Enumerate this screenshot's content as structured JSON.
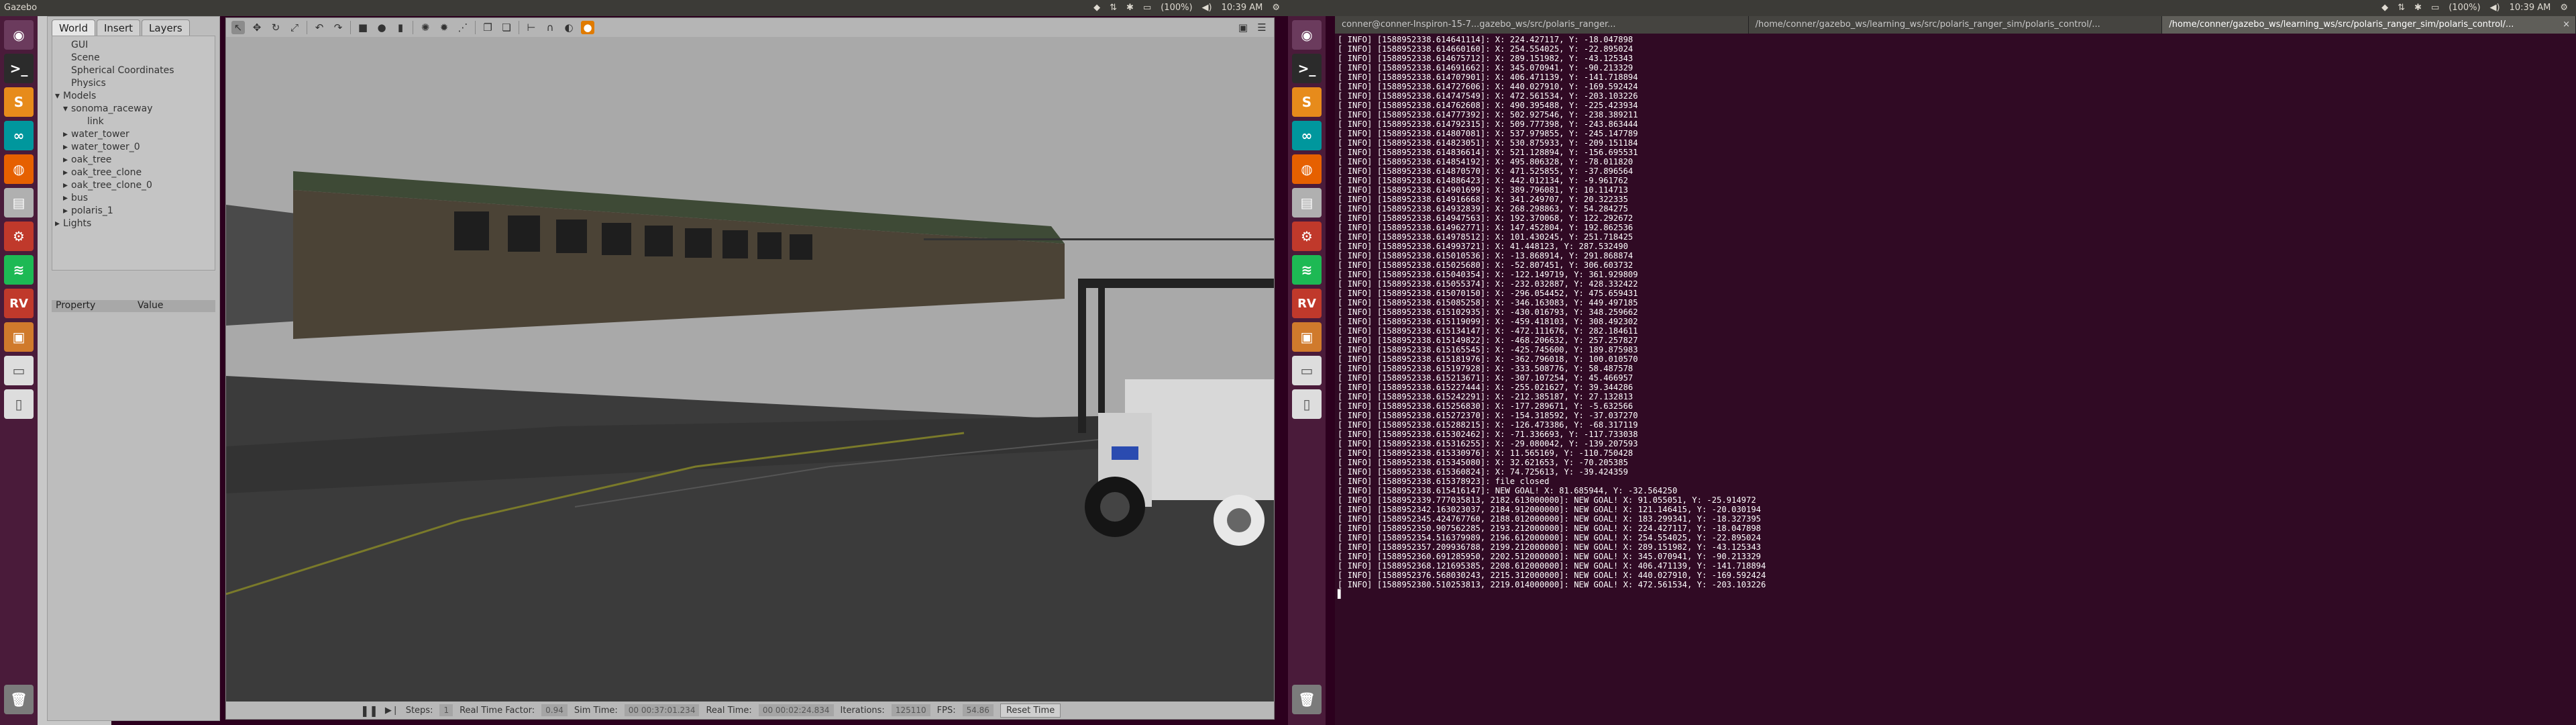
{
  "left_screen": {
    "topbar": {
      "title": "Gazebo"
    },
    "tray": [
      "(100%)",
      "10:39 AM"
    ]
  },
  "right_screen": {
    "tray": [
      "(100%)",
      "10:39 AM"
    ]
  },
  "launcher_icons": [
    "ubuntu-dash-icon",
    "terminal-icon",
    "sublime-text-icon",
    "arduino-icon",
    "firefox-icon",
    "files-icon",
    "settings-icon",
    "spotify-icon",
    "rviz-icon",
    "package-icon",
    "drive-icon",
    "usb-drive-icon",
    "trash-icon"
  ],
  "gazebo": {
    "tabs": [
      "World",
      "Insert",
      "Layers"
    ],
    "tree": [
      {
        "label": "GUI",
        "indent": 1,
        "arrow": ""
      },
      {
        "label": "Scene",
        "indent": 1,
        "arrow": ""
      },
      {
        "label": "Spherical Coordinates",
        "indent": 1,
        "arrow": ""
      },
      {
        "label": "Physics",
        "indent": 1,
        "arrow": ""
      },
      {
        "label": "Models",
        "indent": 0,
        "arrow": "▾"
      },
      {
        "label": "sonoma_raceway",
        "indent": 1,
        "arrow": "▾"
      },
      {
        "label": "link",
        "indent": 3,
        "arrow": ""
      },
      {
        "label": "water_tower",
        "indent": 1,
        "arrow": "▸"
      },
      {
        "label": "water_tower_0",
        "indent": 1,
        "arrow": "▸"
      },
      {
        "label": "oak_tree",
        "indent": 1,
        "arrow": "▸"
      },
      {
        "label": "oak_tree_clone",
        "indent": 1,
        "arrow": "▸"
      },
      {
        "label": "oak_tree_clone_0",
        "indent": 1,
        "arrow": "▸"
      },
      {
        "label": "bus",
        "indent": 1,
        "arrow": "▸"
      },
      {
        "label": "polaris_1",
        "indent": 1,
        "arrow": "▸"
      },
      {
        "label": "Lights",
        "indent": 0,
        "arrow": "▸"
      }
    ],
    "props": {
      "property": "Property",
      "value": "Value"
    },
    "status": {
      "steps_label": "Steps:",
      "steps_value": "1",
      "rtf_label": "Real Time Factor:",
      "rtf_value": "0.94",
      "sim_label": "Sim Time:",
      "sim_value": "00 00:37:01.234",
      "real_label": "Real Time:",
      "real_value": "00 00:02:24.834",
      "iter_label": "Iterations:",
      "iter_value": "125110",
      "fps_label": "FPS:",
      "fps_value": "54.86",
      "reset": "Reset Time"
    }
  },
  "terminal": {
    "tabs": [
      "conner@conner-Inspiron-15-7...gazebo_ws/src/polaris_ranger...",
      "/home/conner/gazebo_ws/learning_ws/src/polaris_ranger_sim/polaris_control/...",
      "/home/conner/gazebo_ws/learning_ws/src/polaris_ranger_sim/polaris_control/..."
    ],
    "close_glyph": "×",
    "lines": [
      "[ INFO] [1588952338.614641114]: X: 224.427117, Y: -18.047898",
      "[ INFO] [1588952338.614660160]: X: 254.554025, Y: -22.895024",
      "[ INFO] [1588952338.614675712]: X: 289.151982, Y: -43.125343",
      "[ INFO] [1588952338.614691662]: X: 345.070941, Y: -90.213329",
      "[ INFO] [1588952338.614707901]: X: 406.471139, Y: -141.718894",
      "[ INFO] [1588952338.614727606]: X: 440.027910, Y: -169.592424",
      "[ INFO] [1588952338.614747549]: X: 472.561534, Y: -203.103226",
      "[ INFO] [1588952338.614762608]: X: 490.395488, Y: -225.423934",
      "[ INFO] [1588952338.614777392]: X: 502.927546, Y: -238.389211",
      "[ INFO] [1588952338.614792315]: X: 509.777398, Y: -243.863444",
      "[ INFO] [1588952338.614807081]: X: 537.979855, Y: -245.147789",
      "[ INFO] [1588952338.614823051]: X: 530.875933, Y: -209.151184",
      "[ INFO] [1588952338.614836614]: X: 521.128894, Y: -156.695531",
      "[ INFO] [1588952338.614854192]: X: 495.806328, Y: -78.011820",
      "[ INFO] [1588952338.614870570]: X: 471.525855, Y: -37.896564",
      "[ INFO] [1588952338.614886423]: X: 442.012134, Y: -9.961762",
      "[ INFO] [1588952338.614901699]: X: 389.796081, Y: 10.114713",
      "[ INFO] [1588952338.614916668]: X: 341.249707, Y: 20.322335",
      "[ INFO] [1588952338.614932839]: X: 268.298863, Y: 54.284275",
      "[ INFO] [1588952338.614947563]: X: 192.370068, Y: 122.292672",
      "[ INFO] [1588952338.614962771]: X: 147.452804, Y: 192.862536",
      "[ INFO] [1588952338.614978512]: X: 101.430245, Y: 251.718425",
      "[ INFO] [1588952338.614993721]: X: 41.448123, Y: 287.532490",
      "[ INFO] [1588952338.615010536]: X: -13.868914, Y: 291.868874",
      "[ INFO] [1588952338.615025680]: X: -52.807451, Y: 306.603732",
      "[ INFO] [1588952338.615040354]: X: -122.149719, Y: 361.929809",
      "[ INFO] [1588952338.615055374]: X: -232.032887, Y: 428.332422",
      "[ INFO] [1588952338.615070150]: X: -296.054452, Y: 475.659431",
      "[ INFO] [1588952338.615085258]: X: -346.163083, Y: 449.497185",
      "[ INFO] [1588952338.615102935]: X: -430.016793, Y: 348.259662",
      "[ INFO] [1588952338.615119099]: X: -459.418103, Y: 308.492302",
      "[ INFO] [1588952338.615134147]: X: -472.111676, Y: 282.184611",
      "[ INFO] [1588952338.615149822]: X: -468.206632, Y: 257.257827",
      "[ INFO] [1588952338.615165545]: X: -425.745600, Y: 189.875983",
      "[ INFO] [1588952338.615181976]: X: -362.796018, Y: 100.010570",
      "[ INFO] [1588952338.615197928]: X: -333.508776, Y: 58.487578",
      "[ INFO] [1588952338.615213671]: X: -307.107254, Y: 45.466957",
      "[ INFO] [1588952338.615227444]: X: -255.021627, Y: 39.344286",
      "[ INFO] [1588952338.615242291]: X: -212.385187, Y: 27.132813",
      "[ INFO] [1588952338.615256830]: X: -177.289671, Y: -5.632566",
      "[ INFO] [1588952338.615272370]: X: -154.318592, Y: -37.037270",
      "[ INFO] [1588952338.615288215]: X: -126.473386, Y: -68.317119",
      "[ INFO] [1588952338.615302462]: X: -71.336693, Y: -117.733038",
      "[ INFO] [1588952338.615316255]: X: -29.080042, Y: -139.207593",
      "[ INFO] [1588952338.615330976]: X: 11.565169, Y: -110.750428",
      "[ INFO] [1588952338.615345080]: X: 32.621653, Y: -70.205385",
      "[ INFO] [1588952338.615360824]: X: 74.725613, Y: -39.424359",
      "[ INFO] [1588952338.615378923]: file closed",
      "[ INFO] [1588952338.615416147]: NEW GOAL! X: 81.685944, Y: -32.564250",
      "[ INFO] [1588952339.777035813, 2182.613000000]: NEW GOAL! X: 91.055051, Y: -25.914972",
      "[ INFO] [1588952342.163023037, 2184.912000000]: NEW GOAL! X: 121.146415, Y: -20.030194",
      "[ INFO] [1588952345.424767760, 2188.012000000]: NEW GOAL! X: 183.299341, Y: -18.327395",
      "[ INFO] [1588952350.907562285, 2193.212000000]: NEW GOAL! X: 224.427117, Y: -18.047898",
      "[ INFO] [1588952354.516379989, 2196.612000000]: NEW GOAL! X: 254.554025, Y: -22.895024",
      "[ INFO] [1588952357.209936788, 2199.212000000]: NEW GOAL! X: 289.151982, Y: -43.125343",
      "[ INFO] [1588952360.691285950, 2202.512000000]: NEW GOAL! X: 345.070941, Y: -90.213329",
      "[ INFO] [1588952368.121695385, 2208.612000000]: NEW GOAL! X: 406.471139, Y: -141.718894",
      "[ INFO] [1588952376.568030243, 2215.312000000]: NEW GOAL! X: 440.027910, Y: -169.592424",
      "[ INFO] [1588952380.510253813, 2219.014000000]: NEW GOAL! X: 472.561534, Y: -203.103226",
      "▋"
    ]
  },
  "colors": {
    "terminal_bg": "#300a24",
    "launcher_bg": "#4a1b3a",
    "accent_orange": "#e95420"
  }
}
